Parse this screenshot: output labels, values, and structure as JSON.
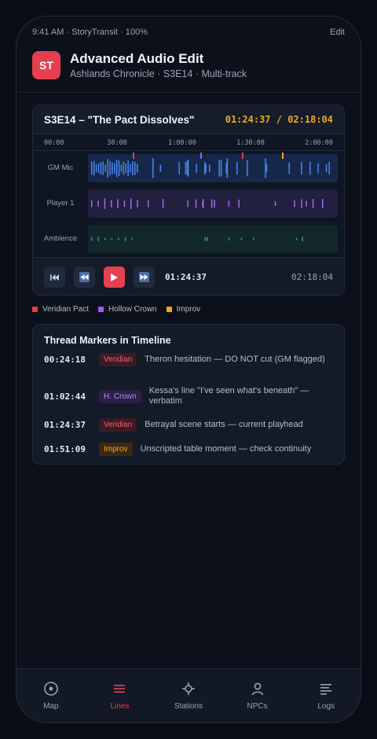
{
  "status_bar": {
    "left": "9:41 AM · StoryTransit · 100%",
    "right": "Edit"
  },
  "header": {
    "app_icon": "ST",
    "title": "Advanced Audio Edit",
    "subtitle": "Ashlands Chronicle · S3E14 · Multi-track"
  },
  "episode": {
    "title": "S3E14 – \"The Pact Dissolves\"",
    "time_display": "01:24:37 / 02:18:04"
  },
  "ruler": [
    "00:00",
    "30:00",
    "1:00:00",
    "1:30:00",
    "2:00:00"
  ],
  "tracks": [
    {
      "label": "GM Mic",
      "color": "#3b6fd6"
    },
    {
      "label": "Player 1",
      "color": "#8e57d6"
    },
    {
      "label": "Ambience",
      "color": "#2a8a78"
    }
  ],
  "controls": {
    "skip_back_icon": "skip-to-start-icon",
    "rewind_icon": "rewind-icon",
    "play_icon": "play-icon",
    "forward_icon": "fast-forward-icon",
    "current_time": "01:24:37",
    "total_time": "02:18:04"
  },
  "legend": [
    {
      "label": "Veridian Pact",
      "color": "#e5404f"
    },
    {
      "label": "Hollow Crown",
      "color": "#9f5cf0"
    },
    {
      "label": "Improv",
      "color": "#f5a524"
    }
  ],
  "markers": {
    "title": "Thread Markers in Timeline",
    "items": [
      {
        "time": "00:24:18",
        "tag": "Veridian",
        "tag_type": "veridian",
        "note": "Theron hesitation — DO NOT cut (GM flagged)"
      },
      {
        "time": "01:02:44",
        "tag": "H. Crown",
        "tag_type": "crown",
        "note": "Kessa's line \"I've seen what's beneath\" — verbatim"
      },
      {
        "time": "01:24:37",
        "tag": "Veridian",
        "tag_type": "veridian",
        "note": "Betrayal scene starts — current playhead"
      },
      {
        "time": "01:51:09",
        "tag": "Improv",
        "tag_type": "improv",
        "note": "Unscripted table moment — check continuity"
      }
    ]
  },
  "nav": [
    {
      "label": "Map",
      "icon": "map-icon"
    },
    {
      "label": "Lines",
      "icon": "lines-icon",
      "active": true
    },
    {
      "label": "Stations",
      "icon": "stations-icon"
    },
    {
      "label": "NPCs",
      "icon": "npcs-icon"
    },
    {
      "label": "Logs",
      "icon": "logs-icon"
    }
  ]
}
